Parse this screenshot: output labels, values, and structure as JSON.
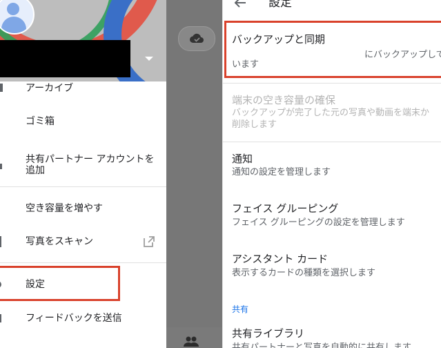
{
  "drawer": {
    "items": [
      {
        "label": "アーカイブ"
      },
      {
        "label": "ゴミ箱"
      },
      {
        "label": "共有パートナー アカウントを\n追加"
      },
      {
        "label": "空き容量を増やす"
      },
      {
        "label": "写真をスキャン"
      },
      {
        "label": "設定"
      },
      {
        "label": "フィードバックを送信"
      }
    ]
  },
  "settings": {
    "title": "設定",
    "items": [
      {
        "title": "バックアップと同期",
        "subtitle": "います",
        "subtitle_right": "にバックアップして"
      },
      {
        "title": "端末の空き容量の確保",
        "subtitle": "バックアップが完了した元の写真や動画を端末か\n削除します"
      },
      {
        "title": "通知",
        "subtitle": "通知の設定を管理します"
      },
      {
        "title": "フェイス グルーピング",
        "subtitle": "フェイス グルーピングの設定を管理します"
      },
      {
        "title": "アシスタント カード",
        "subtitle": "表示するカードの種類を選択します"
      }
    ],
    "section_label": "共有",
    "shared_library": {
      "title": "共有ライブラリ",
      "subtitle": "共有パートナーと写真を自動的に共有します"
    }
  },
  "colors": {
    "highlight": "#d9412b",
    "accent": "#1a73e8"
  }
}
